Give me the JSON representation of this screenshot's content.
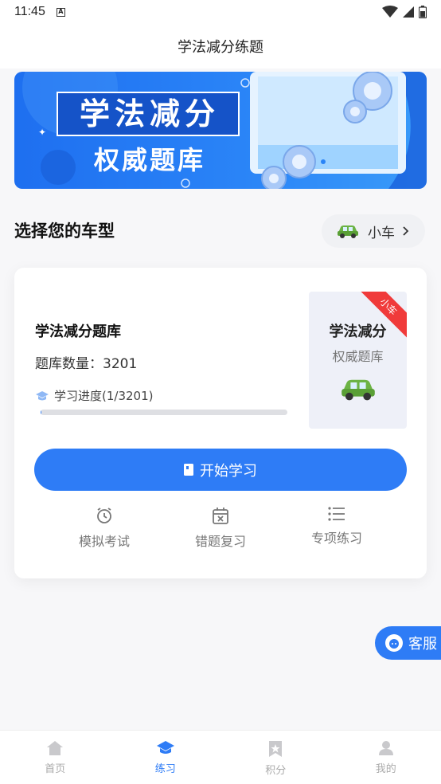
{
  "status": {
    "time": "11:45",
    "a_icon": "A"
  },
  "header": {
    "title": "学法减分练题"
  },
  "banner": {
    "line1": "学法减分",
    "line2": "权威题库"
  },
  "section": {
    "title": "选择您的车型"
  },
  "car_chip": {
    "label": "小车",
    "icon": "car-icon"
  },
  "card": {
    "bank_name": "学法减分题库",
    "count_label": "题库数量：",
    "count_value": "3201",
    "progress_label": "学习进度(1/3201)",
    "progress_fraction": 0.0003,
    "cover": {
      "title": "学法减分",
      "subtitle": "权威题库",
      "ribbon": "小车"
    },
    "start_button": "开始学习",
    "tools": [
      {
        "label": "模拟考试",
        "icon": "alarm-clock-icon"
      },
      {
        "label": "错题复习",
        "icon": "calendar-x-icon"
      },
      {
        "label": "专项练习",
        "icon": "list-icon"
      }
    ]
  },
  "service_button": "客服",
  "tabbar": [
    {
      "label": "首页",
      "icon": "home-icon"
    },
    {
      "label": "练习",
      "icon": "graduation-cap-icon",
      "active": true
    },
    {
      "label": "积分",
      "icon": "badge-star-icon"
    },
    {
      "label": "我的",
      "icon": "user-icon"
    }
  ],
  "colors": {
    "accent": "#2e7cf6",
    "ribbon": "#f03a3a",
    "car": "#6cb344"
  }
}
